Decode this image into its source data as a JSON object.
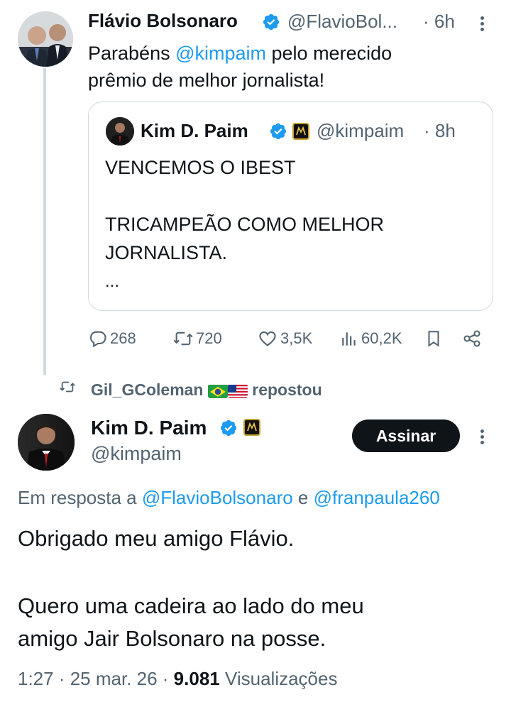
{
  "parent_tweet": {
    "author_name": "Flávio Bolsonaro",
    "handle": "@FlavioBol...",
    "time": "· 6h",
    "text_before": "Parabéns ",
    "mention": "@kimpaim",
    "text_after_line1": " pelo merecido",
    "text_line2": "prêmio de melhor jornalista!",
    "quote": {
      "author_name": "Kim D. Paim",
      "handle": "@kimpaim",
      "time": "· 8h",
      "line1": "VENCEMOS O IBEST",
      "line2": "TRICAMPEÃO COMO MELHOR",
      "line3": "JORNALISTA.",
      "ellipsis": "..."
    },
    "actions": {
      "replies": "268",
      "retweets": "720",
      "likes": "3,5K",
      "views": "60,2K"
    }
  },
  "repost_bar": {
    "user": "Gil_GColeman",
    "label": "repostou"
  },
  "main_tweet": {
    "author_name": "Kim D. Paim",
    "handle": "@kimpaim",
    "subscribe_label": "Assinar",
    "reply_prefix": "Em resposta a ",
    "reply_to_1": "@FlavioBolsonaro",
    "reply_and": " e ",
    "reply_to_2": "@franpaula260",
    "text_line1": "Obrigado meu amigo Flávio.",
    "text_line2": "Quero uma cadeira ao lado do meu",
    "text_line3": "amigo Jair Bolsonaro na posse.",
    "meta_time": "1:27 · 25 mar. 26 · ",
    "meta_views_count": "9.081",
    "meta_views_label": " Visualizações"
  },
  "colors": {
    "accent": "#1d9bf0",
    "text": "#0f1419",
    "muted": "#536471",
    "border": "#cfd9de"
  }
}
